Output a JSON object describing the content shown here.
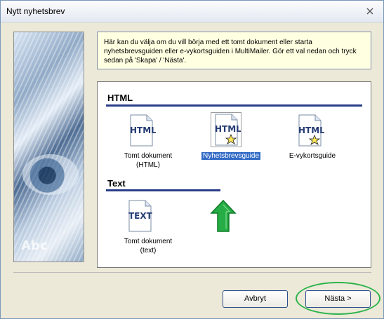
{
  "window": {
    "title": "Nytt nyhetsbrev",
    "close_icon": "close-icon"
  },
  "description": "Här kan du välja om du vill börja med ett tomt dokument eller starta nyhetsbrevsguiden eller e-vykortsguiden i MultiMailer. Gör ett val nedan och tryck sedan på 'Skapa' / 'Nästa'.",
  "sidebar": {
    "image_text": "Abc"
  },
  "sections": {
    "html": {
      "heading": "HTML",
      "items": [
        {
          "label": "Tomt dokument\n(HTML)",
          "icon": "html-document-icon"
        },
        {
          "label": "Nyhetsbrevsguide",
          "icon": "html-wizard-icon",
          "selected": true
        },
        {
          "label": "E-vykortsguide",
          "icon": "html-wizard-icon"
        }
      ]
    },
    "text": {
      "heading": "Text",
      "items": [
        {
          "label": "Tomt dokument\n(text)",
          "icon": "text-document-icon"
        }
      ]
    }
  },
  "buttons": {
    "cancel": "Avbryt",
    "next": "Nästa >"
  },
  "colors": {
    "window_bg": "#ece9d8",
    "accent_line": "#2a3d88",
    "selection": "#316ac5",
    "arrow": "#26ad45",
    "oval": "#2bb34a"
  }
}
